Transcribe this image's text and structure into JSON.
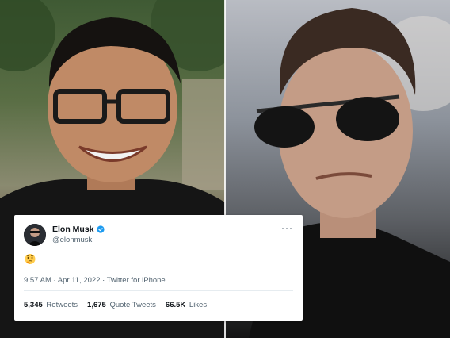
{
  "photos": {
    "left": {
      "subject": "smiling man with glasses",
      "icon": "person-photo-left"
    },
    "right": {
      "subject": "man with sunglasses",
      "icon": "person-photo-right"
    }
  },
  "tweet": {
    "display_name": "Elon Musk",
    "handle": "@elonmusk",
    "verified": true,
    "more_icon": "more-icon",
    "content_emoji": "🤔",
    "time": "9:57 AM",
    "date": "Apr 11, 2022",
    "dot": "·",
    "source": "Twitter for iPhone",
    "stats": {
      "retweets_count": "5,345",
      "retweets_label": "Retweets",
      "quotes_count": "1,675",
      "quotes_label": "Quote Tweets",
      "likes_count": "66.5K",
      "likes_label": "Likes"
    },
    "colors": {
      "text": "#0f1419",
      "muted": "#536471",
      "verified": "#1d9bf0"
    }
  }
}
